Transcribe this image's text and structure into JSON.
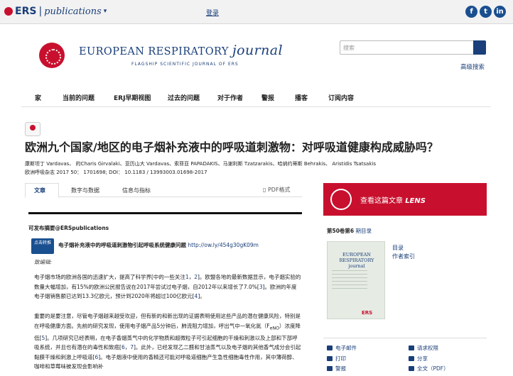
{
  "topbar": {
    "brand": "ERS",
    "brand_sub": "publications",
    "caret": "▾",
    "login": "登录",
    "social": [
      "f",
      "t",
      "in"
    ]
  },
  "masthead": {
    "title": "EUROPEAN RESPIRATORY",
    "title_journal": "journal",
    "tagline": "FLAGSHIP SCIENTIFIC JOURNAL OF ERS"
  },
  "search": {
    "placeholder": "搜索",
    "advanced": "高级搜索"
  },
  "nav": [
    "家",
    "当前的问题",
    "ERJ早期视图",
    "过去的问题",
    "对于作者",
    "警报",
    "播客",
    "订阅内容"
  ],
  "article": {
    "title": "欧洲九个国家/地区的电子烟补充液中的呼吸道刺激物：对呼吸道健康构成威胁吗？",
    "authors": "康斯坦丁 Vardavas、 的Charis Girvalaki、亚历山大 Vardavas、索菲亚 PAPADAKIS、马谢利斯 Tzatzarakis、哈纳约蒂斯 Behrakis、 Aristidis Tsatsakis",
    "citation": "欧洲呼吸杂志 2017 50： 1701698; DOI： 10.1183 / 13993003.01698-2017"
  },
  "tabs": [
    "文章",
    "数字与数据",
    "信息与指标"
  ],
  "pdf_label": "PDF格式",
  "alert": {
    "heading": "可发布摘要@ERSpublications",
    "button": "点击转推",
    "tweet": "电子烟补充液中的呼吸道刺激物引起呼吸系统健康问题",
    "link": "http://ow.ly/454g30gK09m"
  },
  "body": {
    "greeting": "致编辑:",
    "p1a": "电子烟市场的欧洲各国的迅速扩大，提高了科学界[中的一些关注",
    "p1r1": "1",
    "p1b": "，",
    "p1r2": "2",
    "p1c": "]。欧盟各地的最新数据显示，电子烟实验的数量大幅增加，有15%的欧洲公民报告说在2017年尝试过电子烟，自2012年以来增长了7.0%[",
    "p1r3": "3",
    "p1d": "]。欧洲的年度电子烟销售额已达到13.3亿欧元，预计到2020年将超过100亿欧元[",
    "p1r4": "4",
    "p1e": "]。",
    "p2a": "重要的是要注意，尽管电子烟越来越受欢迎，但有新的和新出现的证据表明使用这些产品的潜在健康风险，特别是在呼吸健康方面。先前的研究发现，使用电子烟产品5分钟后，肺流阻力增加，呼出气中一氧化氮（F",
    "p2sub": "eNO",
    "p2b": "）浓度降低[",
    "p2r1": "5",
    "p2c": "]。几项研究已经表明，在电子香烟蒸气中的化学物质和超微粒子可引起细胞的干燥和刺激以及上部和下部呼吸系统，并且也有潜在的毒性和致癌[",
    "p2r2": "6",
    "p2d": "，",
    "p2r3": "7",
    "p2e": "]。此外，已经发现乙二醛和甘油蒸气以及电子烟的其他香气成分会引起黏膜干燥和刺激上呼吸道[",
    "p2r4": "6",
    "p2f": "]。电子烟液中使用的香精还可能对呼吸道细胞产生急性细胞毒性作用，其中薄荷醇、咖啡和草莓味被发现会影响补"
  },
  "lens": {
    "text": "查看这篇文章",
    "brand": "LENS"
  },
  "issue": {
    "label": "第50卷第6",
    "link": "期目录"
  },
  "cover": {
    "title": "EUROPEAN RESPIRATORY journal",
    "ers": "ERS"
  },
  "side_links": [
    "目录",
    "作者索引"
  ],
  "tools": [
    "电子邮件",
    "打印",
    "警报",
    "请求权限",
    "分享",
    "全文（PDF）"
  ]
}
